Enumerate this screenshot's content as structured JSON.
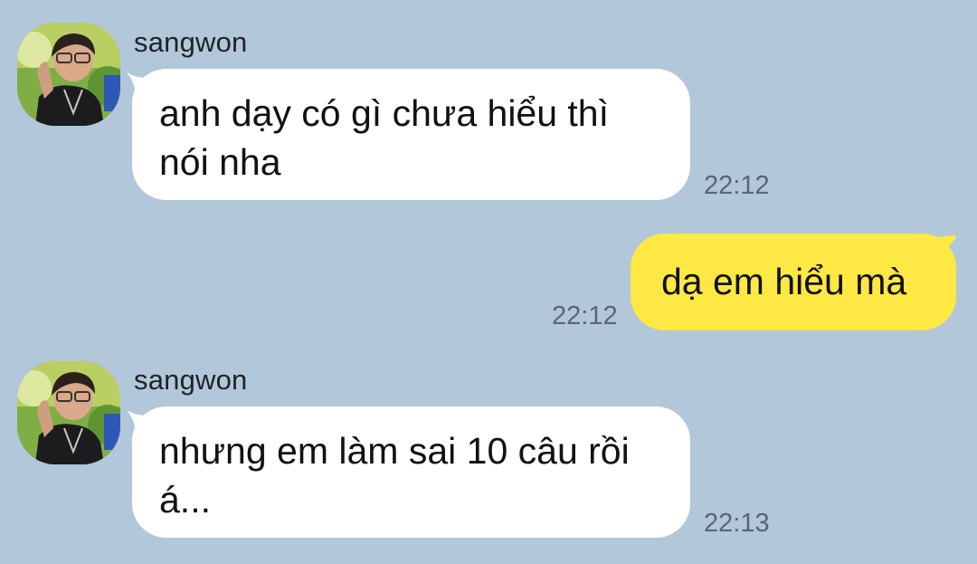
{
  "colors": {
    "background": "#b2c7d9",
    "incoming_bubble": "#ffffff",
    "outgoing_bubble": "#fee843",
    "timestamp": "#5b6670"
  },
  "messages": [
    {
      "direction": "incoming",
      "sender": "sangwon",
      "avatar": "profile-photo",
      "text": "anh dạy có gì chưa hiểu thì nói nha",
      "time": "22:12"
    },
    {
      "direction": "outgoing",
      "text": "dạ em hiểu mà",
      "time": "22:12"
    },
    {
      "direction": "incoming",
      "sender": "sangwon",
      "avatar": "profile-photo",
      "text": "nhưng em làm sai 10 câu rồi á...",
      "time": "22:13"
    }
  ]
}
